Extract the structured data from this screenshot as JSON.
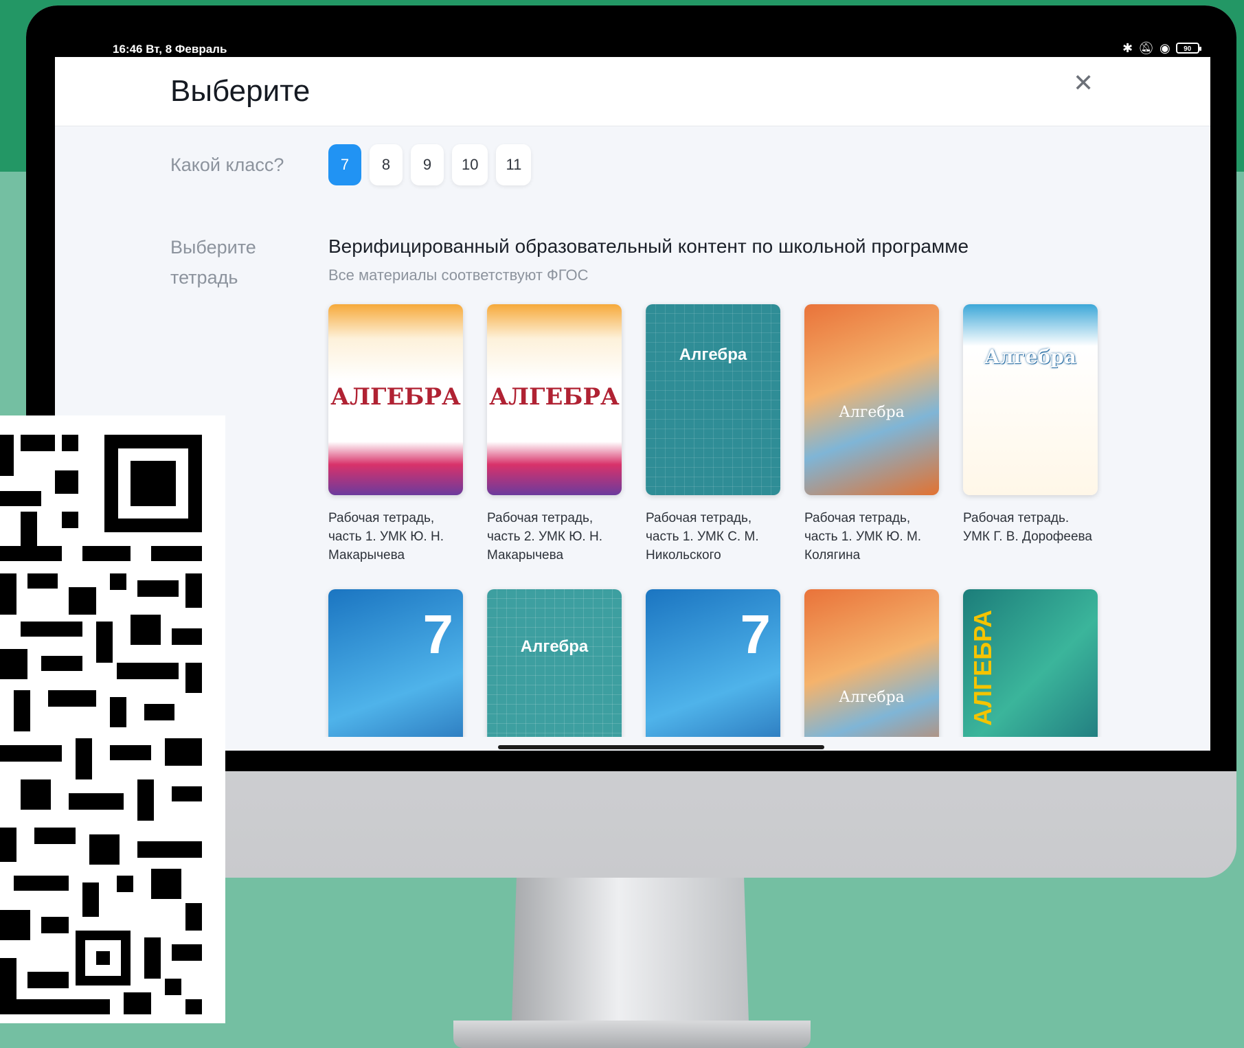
{
  "status_bar": {
    "time_date": "16:46  Вт, 8 Февраль",
    "icons": [
      "bluetooth-icon",
      "mute-icon",
      "wifi-icon",
      "battery-icon"
    ],
    "battery": "90"
  },
  "dialog": {
    "title": "Выберите",
    "close_icon": "close-icon"
  },
  "grade": {
    "label": "Какой класс?",
    "options": [
      "7",
      "8",
      "9",
      "10",
      "11"
    ],
    "selected": "7"
  },
  "notebook": {
    "label": "Выберите тетрадь",
    "section_title": "Верифицированный образовательный контент по школьной программе",
    "section_subtitle": "Все материалы соответствуют ФГОС"
  },
  "books": [
    {
      "title": "Рабочая тетрадь, часть 1. УМК Ю. Н. Макарычева",
      "cover_text": "АЛГЕБРА"
    },
    {
      "title": "Рабочая тетрадь, часть 2. УМК Ю. Н. Макарычева",
      "cover_text": "АЛГЕБРА"
    },
    {
      "title": "Рабочая тетрадь, часть 1. УМК С. М. Никольского",
      "cover_text": "Алгебра"
    },
    {
      "title": "Рабочая тетрадь, часть 1. УМК Ю. М. Колягина",
      "cover_text": "Алгебра"
    },
    {
      "title": "Рабочая тетрадь. УМК Г. В. Дорофеева",
      "cover_text": "Алгебра"
    },
    {
      "title": "",
      "cover_text": "7"
    },
    {
      "title": "",
      "cover_text": "Алгебра"
    },
    {
      "title": "",
      "cover_text": "7"
    },
    {
      "title": "",
      "cover_text": "Алгебра"
    },
    {
      "title": "",
      "cover_text": "АЛГЕБРА"
    }
  ],
  "colors": {
    "accent": "#2193f3",
    "background_green_dark": "#239765",
    "background_green_light": "#74bfa2"
  }
}
